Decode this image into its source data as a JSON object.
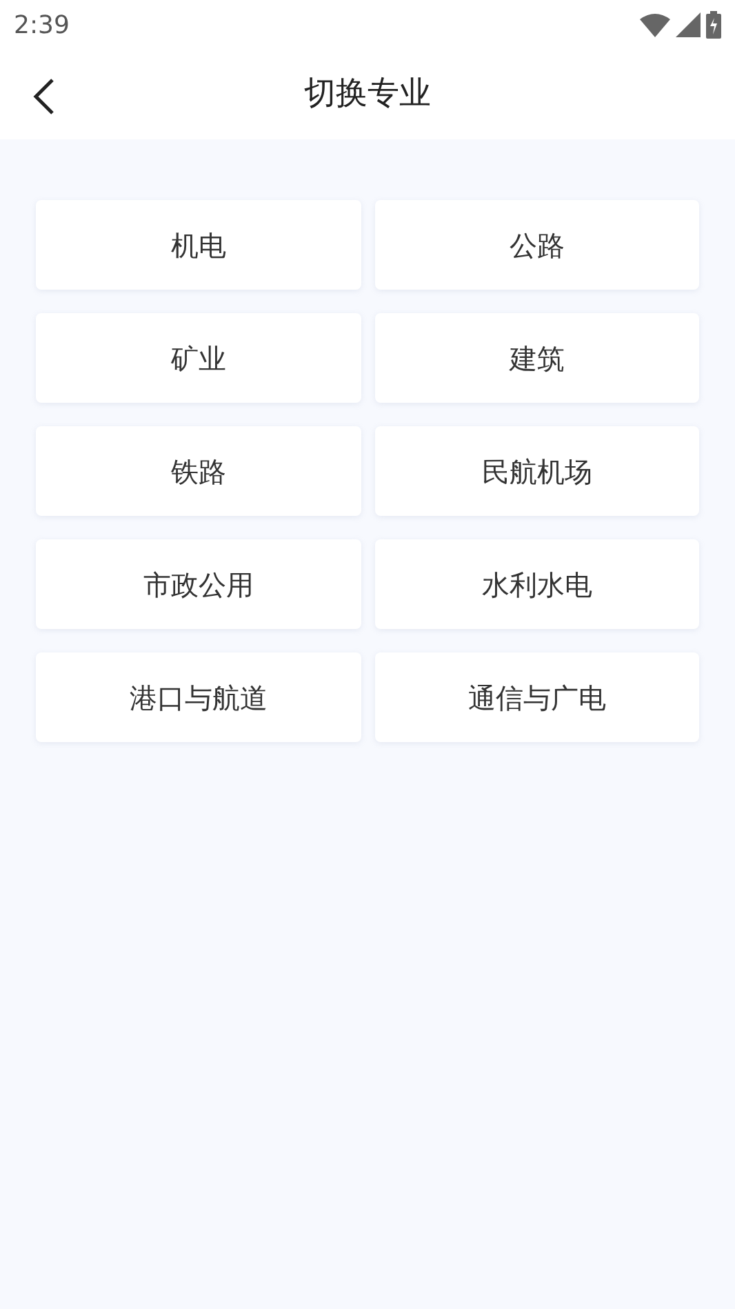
{
  "status_bar": {
    "time": "2:39"
  },
  "header": {
    "title": "切换专业"
  },
  "majors": [
    {
      "label": "机电"
    },
    {
      "label": "公路"
    },
    {
      "label": "矿业"
    },
    {
      "label": "建筑"
    },
    {
      "label": "铁路"
    },
    {
      "label": "民航机场"
    },
    {
      "label": "市政公用"
    },
    {
      "label": "水利水电"
    },
    {
      "label": "港口与航道"
    },
    {
      "label": "通信与广电"
    }
  ]
}
